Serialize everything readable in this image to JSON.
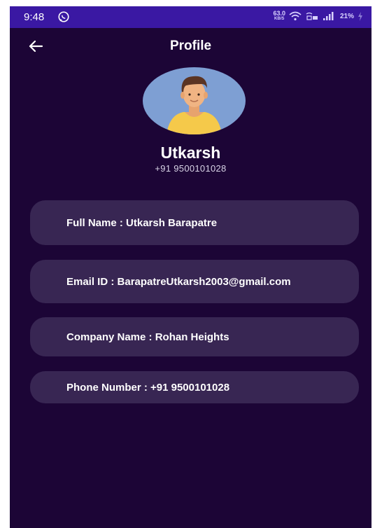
{
  "status_bar": {
    "time": "9:48",
    "network_speed_value": "63.0",
    "network_speed_unit": "KB/S",
    "battery": "21%",
    "icons": [
      "whatsapp-icon",
      "wifi-icon",
      "volte-icon",
      "signal-icon",
      "battery-charging-icon"
    ]
  },
  "header": {
    "title": "Profile",
    "back_icon": "arrow-left-icon"
  },
  "profile": {
    "name": "Utkarsh",
    "phone": "+91 9500101028",
    "avatar_icon": "user-avatar-icon"
  },
  "details": [
    {
      "label": "Full Name :",
      "value": " Utkarsh Barapatre"
    },
    {
      "label": "Email ID :",
      "value": " BarapatreUtkarsh2003@gmail.com"
    },
    {
      "label": "Company Name :",
      "value": " Rohan Heights"
    },
    {
      "label": "Phone Number :",
      "value": " +91 9500101028"
    }
  ],
  "colors": {
    "background": "#1c0536",
    "status_bar": "#3a18a3",
    "card": "#382653",
    "text": "#ffffff"
  }
}
